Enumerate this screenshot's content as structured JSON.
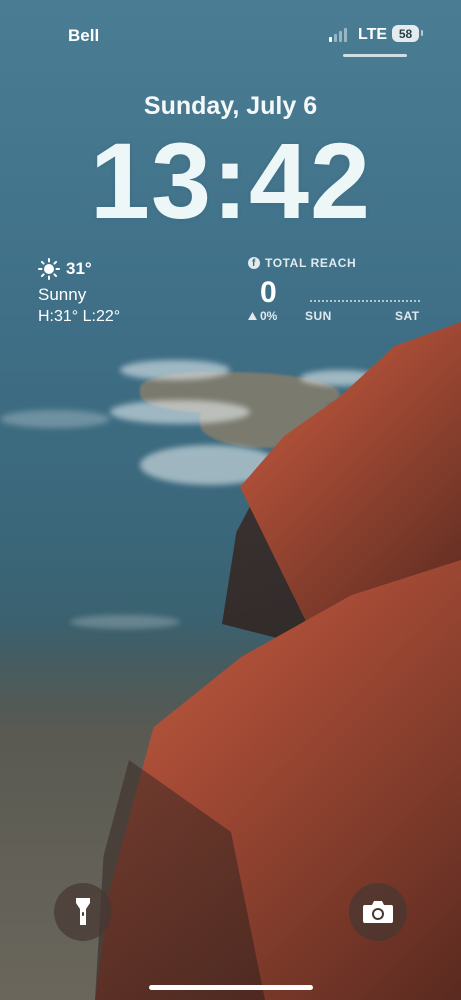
{
  "status_bar": {
    "carrier": "Bell",
    "network": "LTE",
    "battery": "58",
    "signal_bars_active": 1,
    "signal_bars_total": 4
  },
  "lock_screen": {
    "date": "Sunday, July 6",
    "time": "13:42"
  },
  "weather_widget": {
    "icon": "sun-icon",
    "temperature": "31°",
    "condition": "Sunny",
    "high_low": "H:31° L:22°"
  },
  "reach_widget": {
    "icon": "facebook-icon",
    "title": "TOTAL REACH",
    "value": "0",
    "change_icon": "up-triangle-icon",
    "change": "0%",
    "start_day": "SUN",
    "end_day": "SAT"
  },
  "controls": {
    "left_icon": "flashlight-icon",
    "right_icon": "camera-icon"
  },
  "colors": {
    "text": "#ffffff",
    "button_bg": "#46372f"
  }
}
